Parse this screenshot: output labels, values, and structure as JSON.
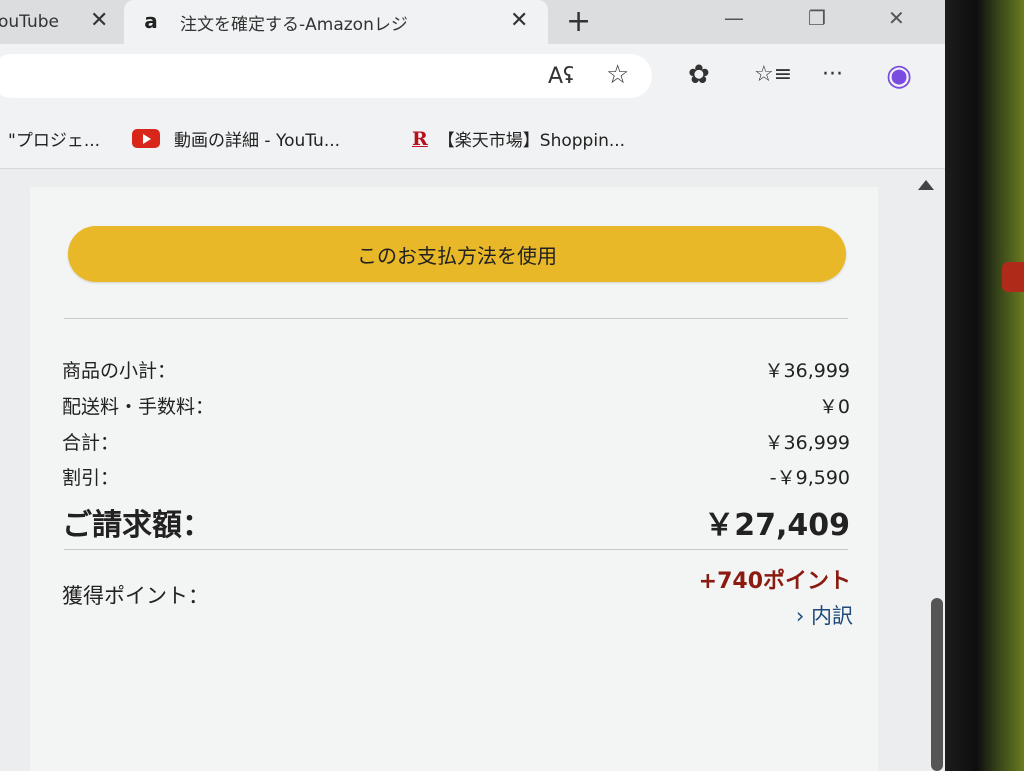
{
  "tabs": [
    {
      "title": "ouTube",
      "close": "✕"
    },
    {
      "favicon": "a",
      "title": "注文を確定する-Amazonレジ",
      "close": "✕"
    }
  ],
  "window": {
    "new_tab": "+",
    "minimize": "—",
    "maximize": "❐",
    "close": "✕"
  },
  "toolbar": {
    "read_aloud": "Aʢ",
    "favorite": "☆",
    "extensions": "✿",
    "favorites_list": "☆≡",
    "more": "···",
    "copilot": "◉"
  },
  "favorites_bar": [
    {
      "label": "\"プロジェ..."
    },
    {
      "label": "動画の詳細 - YouTu..."
    },
    {
      "icon_text": "R",
      "label": "【楽天市場】Shoppin..."
    }
  ],
  "payment": {
    "use_button": "このお支払方法を使用"
  },
  "summary": {
    "subtotal_label": "商品の小計：",
    "subtotal_value": "￥36,999",
    "shipping_label": "配送料・手数料：",
    "shipping_value": "￥0",
    "sum_label": "合計：",
    "sum_value": "￥36,999",
    "discount_label": "割引：",
    "discount_value": "-￥9,590",
    "total_label": "ご請求額：",
    "total_value": "￥27,409",
    "points_label": "獲得ポイント：",
    "points_value": "+740ポイント",
    "breakdown_link": "› 内訳"
  },
  "colors": {
    "accent_button": "#e8b828",
    "points": "#8b1a10",
    "link": "#1f4a7a"
  }
}
